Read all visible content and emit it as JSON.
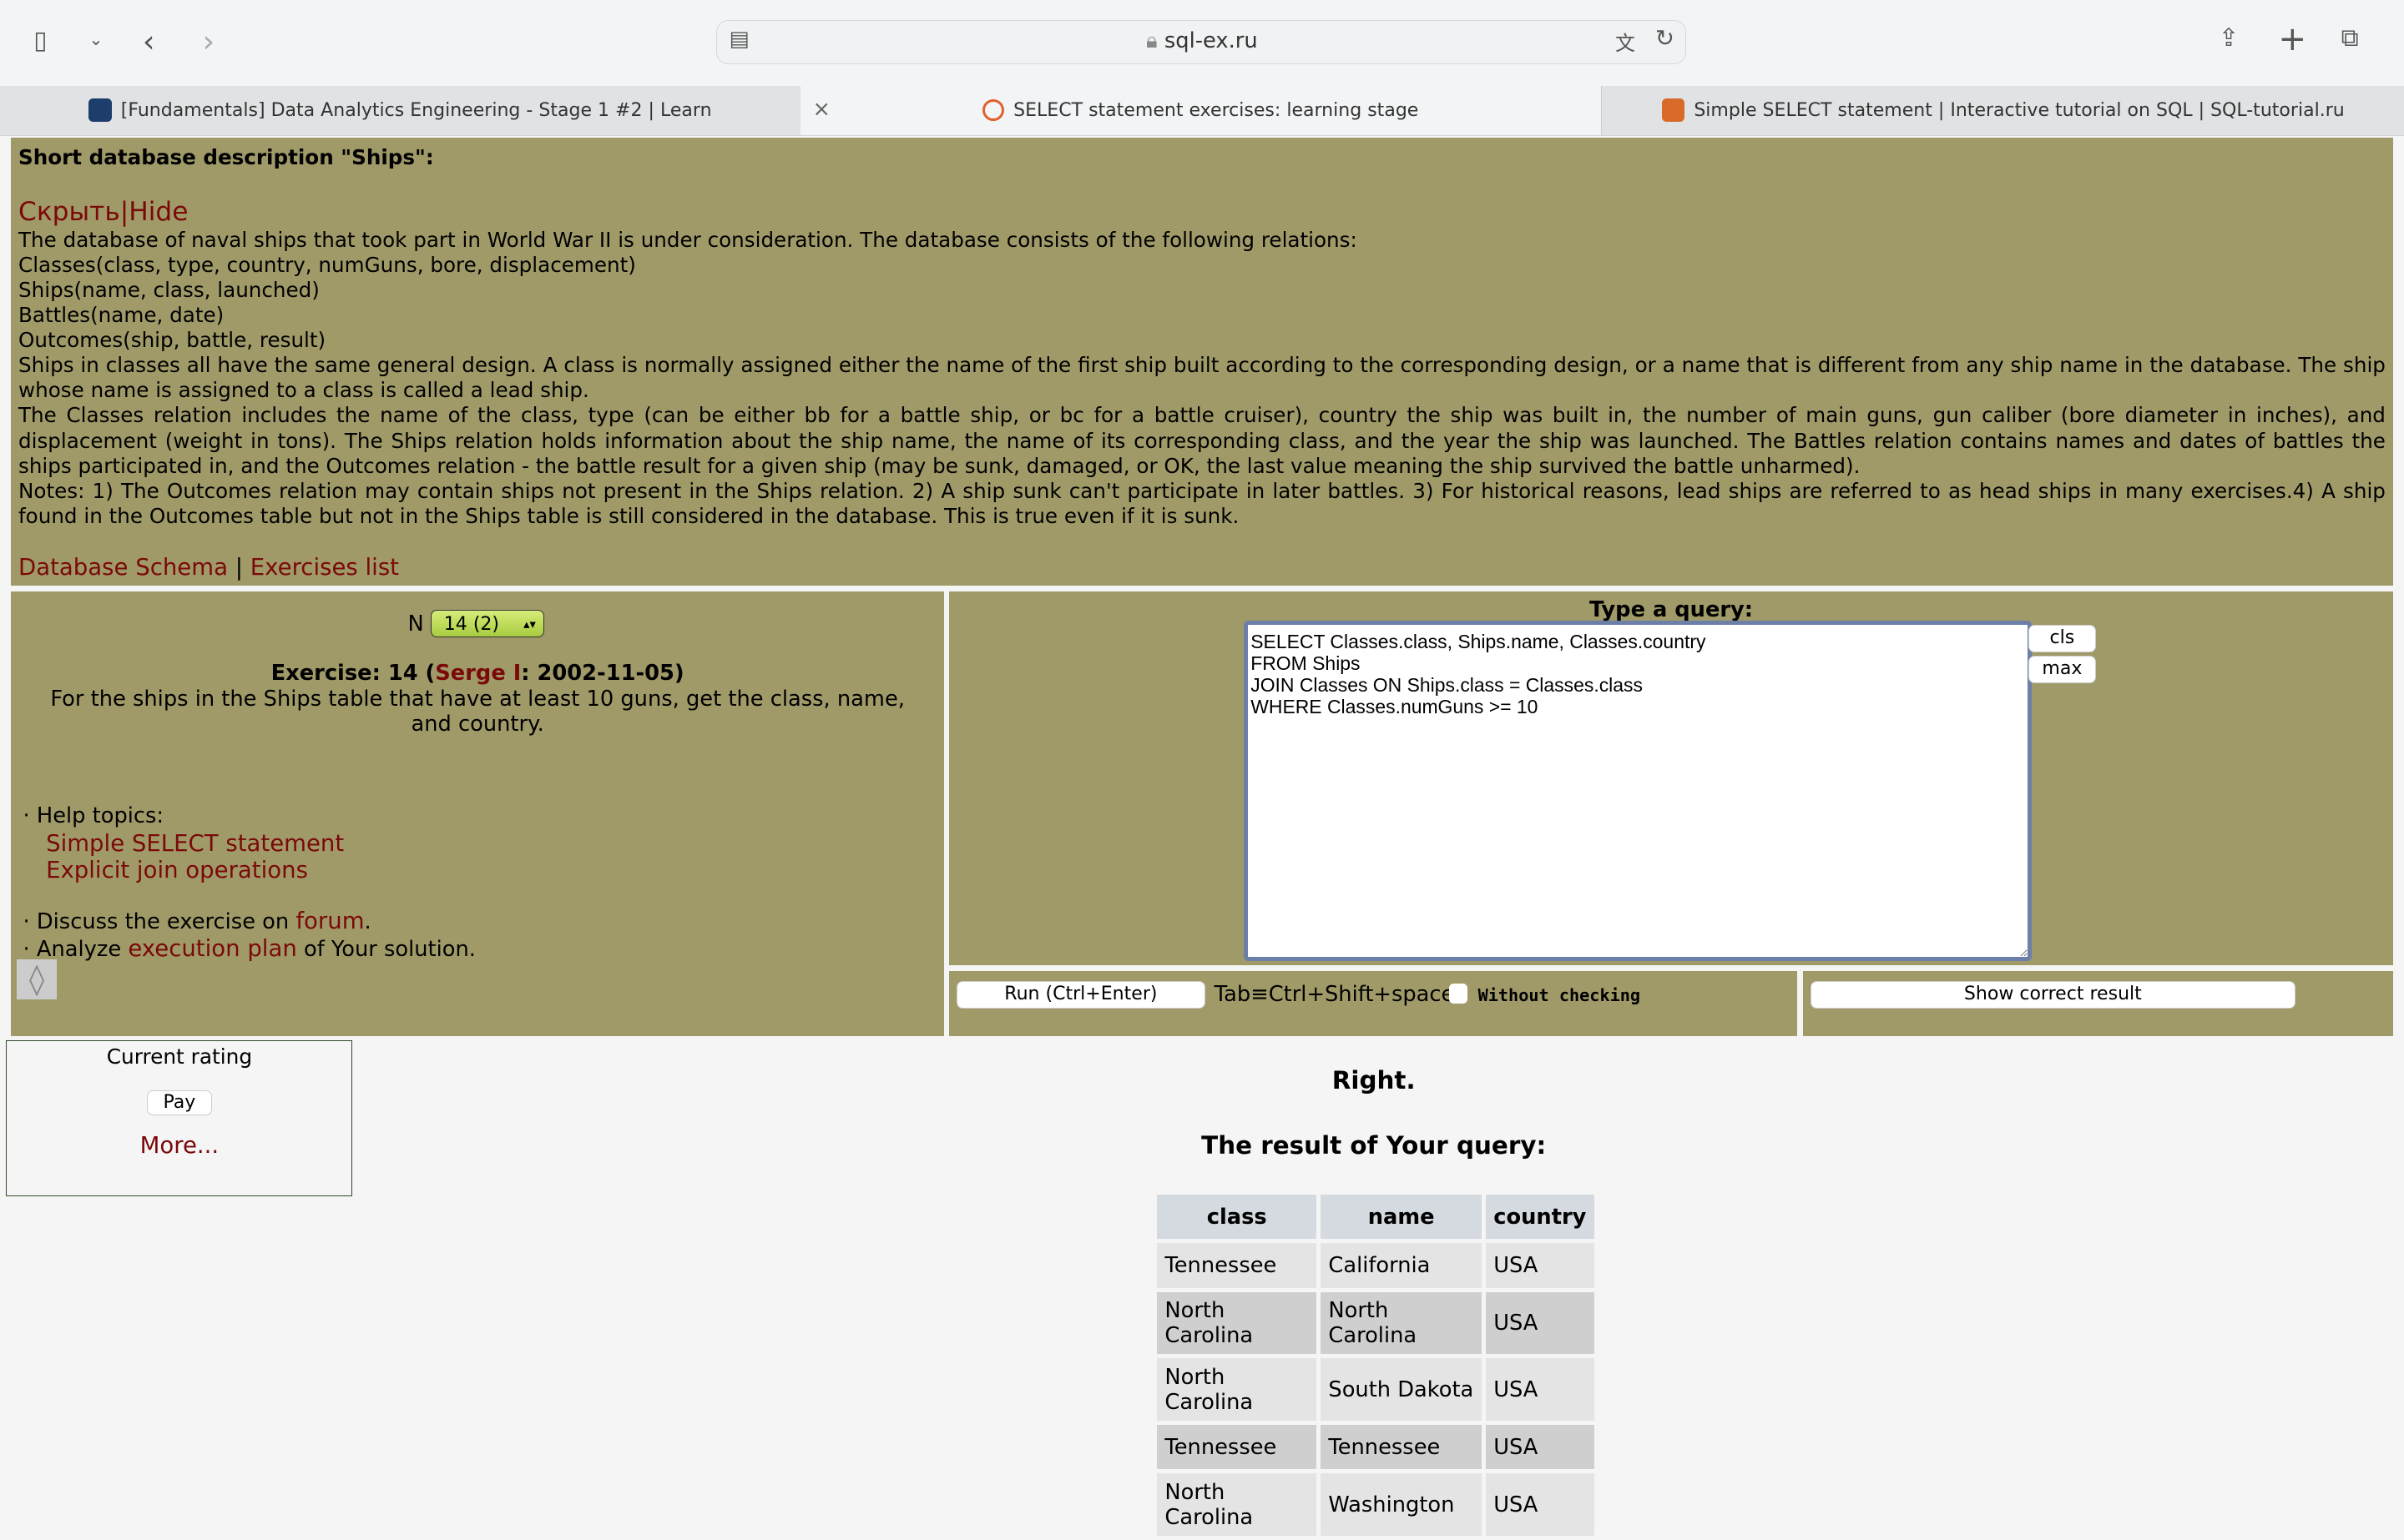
{
  "browser": {
    "url": "sql-ex.ru",
    "tabs": [
      {
        "label": "[Fundamentals] Data Analytics Engineering - Stage 1 #2 | Learn"
      },
      {
        "label": "SELECT statement exercises: learning stage"
      },
      {
        "label": "Simple SELECT statement | Interactive tutorial on SQL | SQL-tutorial.ru"
      }
    ],
    "close_glyph": "×"
  },
  "description": {
    "title": "Short database description \"Ships\":",
    "toggle": "Скрыть|Hide",
    "paragraphs": [
      "The database of naval ships that took part in World War II is under consideration. The database consists of the following relations:",
      "Classes(class, type, country, numGuns, bore, displacement)",
      "Ships(name, class, launched)",
      "Battles(name, date)",
      "Outcomes(ship, battle, result)",
      "Ships in classes all have the same general design. A class is normally assigned either the name of the first ship built according to the corresponding design, or a name that is different from any ship name in the database. The ship whose name is assigned to a class is called a lead ship.",
      "The Classes relation includes the name of the class, type (can be either bb for a battle ship, or bc for a battle cruiser), country the ship was built in, the number of main guns, gun caliber (bore diameter in inches), and displacement (weight in tons). The Ships relation holds information about the ship name, the name of its corresponding class, and the year the ship was launched. The Battles relation contains names and dates of battles the ships participated in, and the Outcomes relation - the battle result for a given ship (may be sunk, damaged, or OK, the last value meaning the ship survived the battle unharmed).",
      "Notes: 1) The Outcomes relation may contain ships not present in the Ships relation. 2) A ship sunk can't participate in later battles. 3) For historical reasons, lead ships are referred to as head ships in many exercises.4) A ship found in the Outcomes table but not in the Ships table is still considered in the database. This is true even if it is sunk."
    ],
    "schema_link": "Database Schema",
    "sep": "|",
    "exercises_link": "Exercises list"
  },
  "exercise": {
    "n_label": "N",
    "n_value": "14 (2)",
    "prefix": "Exercise: 14 (",
    "author": "Serge I",
    "date": ": 2002-11-05)",
    "text": "For the ships in the Ships table that have at least 10 guns, get the class, name, and country.",
    "help_label": "Help topics:",
    "help_links": [
      "Simple SELECT statement",
      "Explicit join operations"
    ],
    "discuss_prefix": "Discuss the exercise on ",
    "forum": "forum",
    "dot": ".",
    "analyze_prefix": "Analyze ",
    "plan": "execution plan",
    "analyze_suffix": " of Your solution."
  },
  "query": {
    "label": "Type a query:",
    "text": "SELECT Classes.class, Ships.name, Classes.country\nFROM Ships\nJOIN Classes ON Ships.class = Classes.class\nWHERE Classes.numGuns >= 10",
    "cls": "cls",
    "max": "max",
    "run": "Run (Ctrl+Enter)",
    "tab_hint": "Tab≡Ctrl+Shift+space",
    "without_checking": "Without checking",
    "show_correct": "Show correct result"
  },
  "rating": {
    "title": "Current rating",
    "pay": "Pay",
    "more": "More..."
  },
  "result": {
    "status": "Right.",
    "title": "The result of Your query:",
    "columns": [
      "class",
      "name",
      "country"
    ],
    "rows": [
      [
        "Tennessee",
        "California",
        "USA"
      ],
      [
        "North Carolina",
        "North Carolina",
        "USA"
      ],
      [
        "North Carolina",
        "South Dakota",
        "USA"
      ],
      [
        "Tennessee",
        "Tennessee",
        "USA"
      ],
      [
        "North Carolina",
        "Washington",
        "USA"
      ]
    ]
  }
}
